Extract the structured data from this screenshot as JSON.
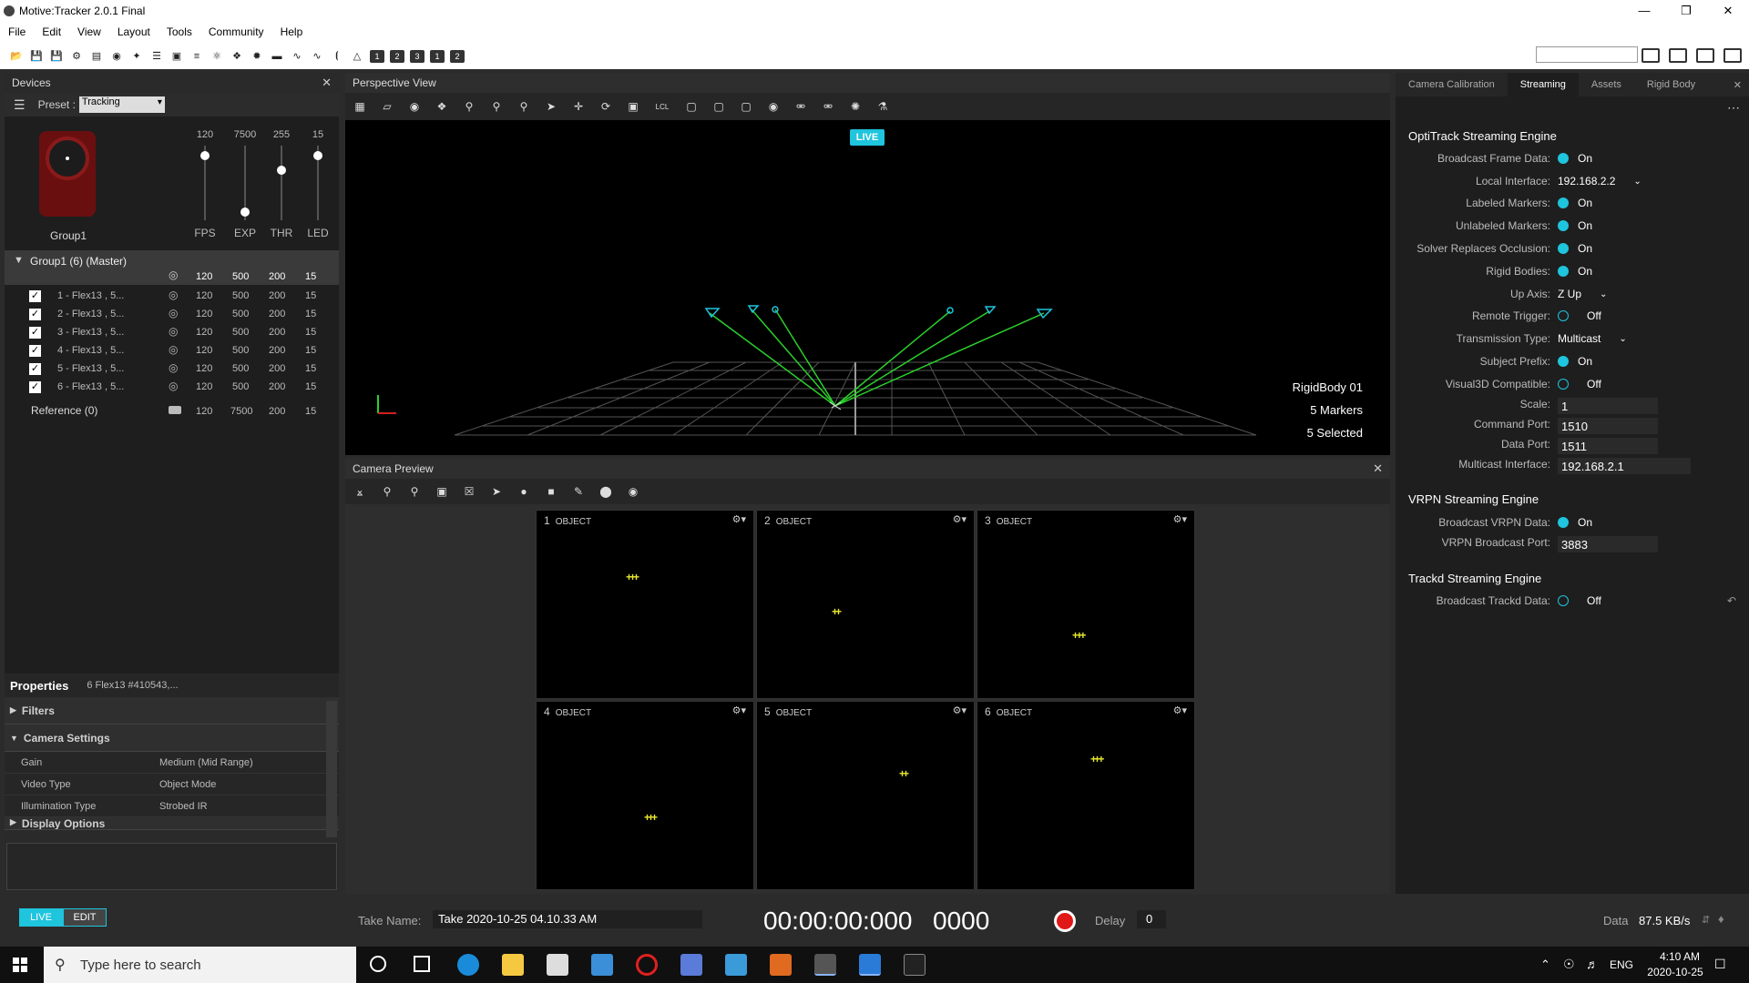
{
  "window": {
    "title": "Motive:Tracker 2.0.1 Final"
  },
  "menu": [
    "File",
    "Edit",
    "View",
    "Layout",
    "Tools",
    "Community",
    "Help"
  ],
  "toolbar": {
    "num_buttons": [
      "1",
      "2",
      "3",
      "1",
      "2"
    ]
  },
  "devices": {
    "title": "Devices",
    "preset_label": "Preset :",
    "preset_value": "Tracking",
    "group_label": "Group1",
    "sliders": [
      {
        "value": "120",
        "label": "FPS",
        "level": 0.9
      },
      {
        "value": "7500",
        "label": "EXP",
        "level": 0.1
      },
      {
        "value": "255",
        "label": "THR",
        "level": 0.62
      },
      {
        "value": "15",
        "label": "LED",
        "level": 0.9
      }
    ],
    "group_row": {
      "name": "Group1 (6) (Master)",
      "fps": "120",
      "exp": "500",
      "thr": "200",
      "led": "15"
    },
    "cameras": [
      {
        "name": "1 - Flex13 , 5...",
        "fps": "120",
        "exp": "500",
        "thr": "200",
        "led": "15"
      },
      {
        "name": "2 - Flex13 , 5...",
        "fps": "120",
        "exp": "500",
        "thr": "200",
        "led": "15"
      },
      {
        "name": "3 - Flex13 , 5...",
        "fps": "120",
        "exp": "500",
        "thr": "200",
        "led": "15"
      },
      {
        "name": "4 - Flex13 , 5...",
        "fps": "120",
        "exp": "500",
        "thr": "200",
        "led": "15"
      },
      {
        "name": "5 - Flex13 , 5...",
        "fps": "120",
        "exp": "500",
        "thr": "200",
        "led": "15"
      },
      {
        "name": "6 - Flex13 , 5...",
        "fps": "120",
        "exp": "500",
        "thr": "200",
        "led": "15"
      }
    ],
    "reference": {
      "name": "Reference (0)",
      "fps": "120",
      "exp": "7500",
      "thr": "200",
      "led": "15"
    }
  },
  "properties": {
    "title": "Properties",
    "subtitle": "6 Flex13 #410543,...",
    "filters": "Filters",
    "camera_settings": "Camera Settings",
    "rows": [
      {
        "k": "Gain",
        "v": "Medium (Mid Range)"
      },
      {
        "k": "Video Type",
        "v": "Object Mode"
      },
      {
        "k": "Illumination Type",
        "v": "Strobed IR"
      }
    ],
    "display_options": "Display Options"
  },
  "perspective": {
    "title": "Perspective View",
    "live": "LIVE",
    "rigidbody": "RigidBody 01",
    "markers": "5 Markers",
    "selected": "5 Selected",
    "lcl": "LCL"
  },
  "camera_preview": {
    "title": "Camera Preview",
    "cells": [
      {
        "num": "1",
        "mode": "OBJECT",
        "marks": "+++"
      },
      {
        "num": "2",
        "mode": "OBJECT",
        "marks": "++"
      },
      {
        "num": "3",
        "mode": "OBJECT",
        "marks": "+ ++"
      },
      {
        "num": "4",
        "mode": "OBJECT",
        "marks": "+++"
      },
      {
        "num": "5",
        "mode": "OBJECT",
        "marks": "++"
      },
      {
        "num": "6",
        "mode": "OBJECT",
        "marks": "++ +"
      }
    ]
  },
  "right_panel": {
    "tabs": [
      "Camera Calibration",
      "Streaming",
      "Assets",
      "Rigid Body"
    ],
    "active_tab": "Streaming",
    "sections": {
      "optitrack": "OptiTrack Streaming Engine",
      "vrpn": "VRPN Streaming Engine",
      "trackd": "Trackd Streaming Engine"
    },
    "optitrack_rows": [
      {
        "label": "Broadcast Frame Data:",
        "value": "On",
        "type": "on"
      },
      {
        "label": "Local Interface:",
        "value": "192.168.2.2",
        "type": "drop"
      },
      {
        "label": "Labeled Markers:",
        "value": "On",
        "type": "on"
      },
      {
        "label": "Unlabeled Markers:",
        "value": "On",
        "type": "on"
      },
      {
        "label": "Solver Replaces Occlusion:",
        "value": "On",
        "type": "on"
      },
      {
        "label": "Rigid Bodies:",
        "value": "On",
        "type": "on"
      },
      {
        "label": "Up Axis:",
        "value": "Z Up",
        "type": "drop"
      },
      {
        "label": "Remote Trigger:",
        "value": "Off",
        "type": "off"
      },
      {
        "label": "Transmission Type:",
        "value": "Multicast",
        "type": "drop"
      },
      {
        "label": "Subject Prefix:",
        "value": "On",
        "type": "on"
      },
      {
        "label": "Visual3D Compatible:",
        "value": "Off",
        "type": "off"
      },
      {
        "label": "Scale:",
        "value": "1",
        "type": "input"
      },
      {
        "label": "Command Port:",
        "value": "1510",
        "type": "input"
      },
      {
        "label": "Data Port:",
        "value": "1511",
        "type": "input"
      },
      {
        "label": "Multicast Interface:",
        "value": "192.168.2.1",
        "type": "input"
      }
    ],
    "vrpn_rows": [
      {
        "label": "Broadcast VRPN Data:",
        "value": "On",
        "type": "on"
      },
      {
        "label": "VRPN Broadcast Port:",
        "value": "3883",
        "type": "input"
      }
    ],
    "trackd_rows": [
      {
        "label": "Broadcast Trackd Data:",
        "value": "Off",
        "type": "off"
      }
    ]
  },
  "bottom": {
    "live": "LIVE",
    "edit": "EDIT",
    "take_label": "Take Name:",
    "take_name": "Take 2020-10-25 04.10.33 AM",
    "timecode": "00:00:00:000",
    "frame": "0000",
    "delay_label": "Delay",
    "delay_value": "0",
    "data_label": "Data",
    "data_rate": "87.5 KB/s"
  },
  "taskbar": {
    "search_placeholder": "Type here to search",
    "lang": "ENG",
    "time": "4:10 AM",
    "date": "2020-10-25"
  }
}
